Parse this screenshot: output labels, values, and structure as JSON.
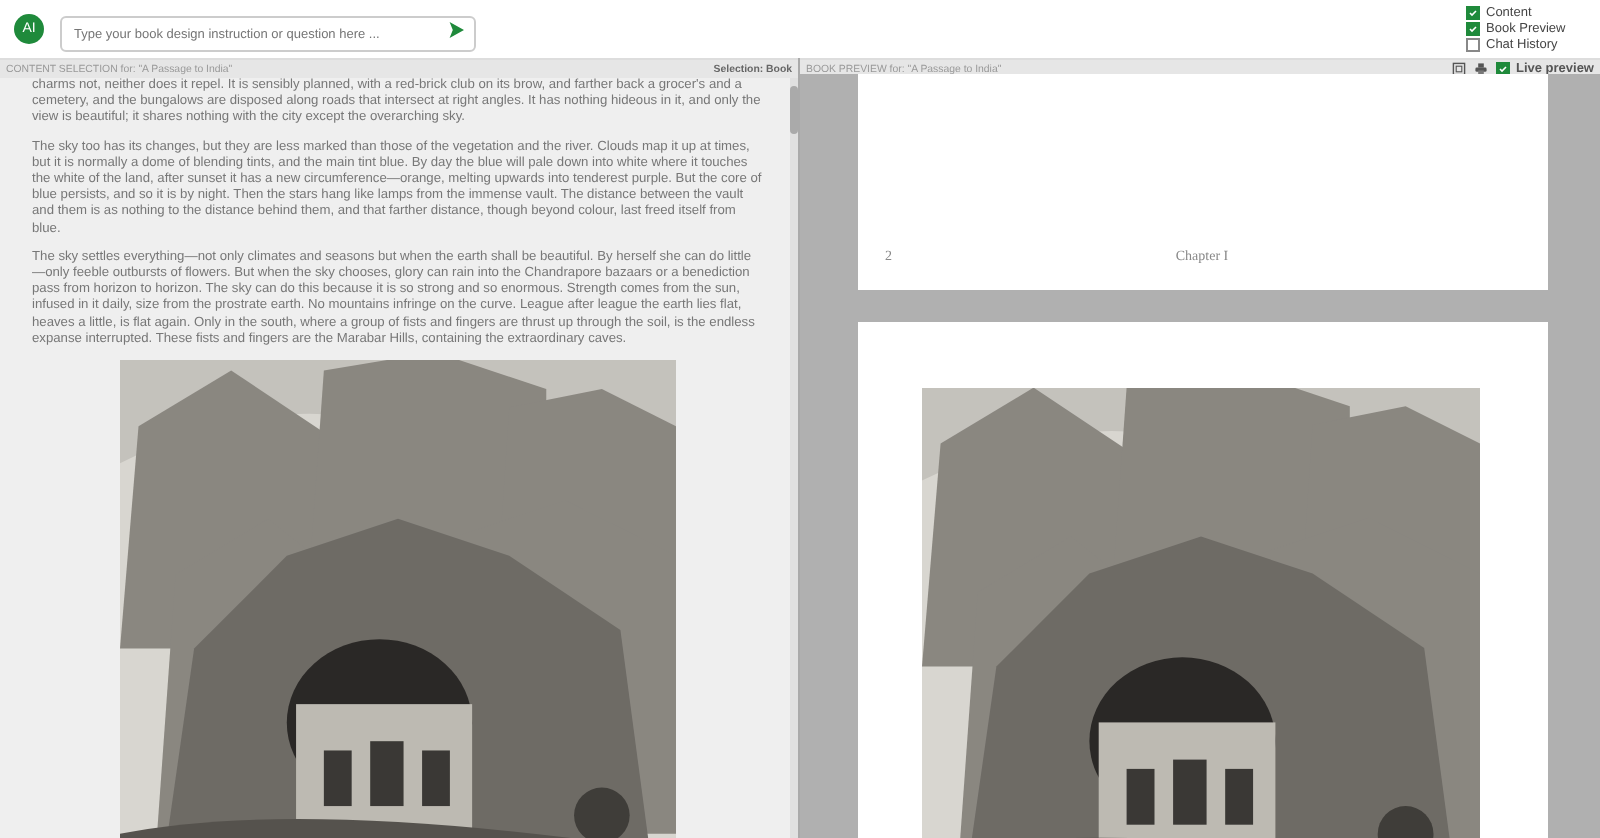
{
  "chat": {
    "avatar": "AI",
    "placeholder": "Type your book design instruction or question here ..."
  },
  "view_options": [
    {
      "label": "Content",
      "checked": true
    },
    {
      "label": "Book Preview",
      "checked": true
    },
    {
      "label": "Chat History",
      "checked": false
    }
  ],
  "content_panel": {
    "title": "CONTENT SELECTION for: \"A Passage to India\"",
    "selection": "Selection: Book",
    "paragraphs": [
      "charms not, neither does it repel. It is sensibly planned, with a red-brick club on its brow, and farther back a grocer's and a cemetery, and the bungalows are disposed along roads that intersect at right angles. It has nothing hideous in it, and only the view is beautiful; it shares nothing with the city except the overarching sky.",
      "The sky too has its changes, but they are less marked than those of the vegetation and the river. Clouds map it up at times, but it is normally a dome of blending tints, and the main tint blue. By day the blue will pale down into white where it touches the white of the land, after sunset it has a new circumference—orange, melting upwards into tenderest purple. But the core of blue persists, and so it is by night. Then the stars hang like lamps from the immense vault. The distance between the vault and them is as nothing to the distance behind them, and that farther distance, though beyond colour, last freed itself from blue.",
      "The sky settles everything—not only climates and seasons but when the earth shall be beautiful. By herself she can do little—only feeble outbursts of flowers. But when the sky chooses, glory can rain into the Chandrapore bazaars or a benediction pass from horizon to horizon. The sky can do this because it is so strong and so enormous. Strength comes from the sun, infused in it daily, size from the prostrate earth. No mountains infringe on the curve. League after league the earth lies flat, heaves a little, is flat again. Only in the south, where a group of fists and fingers are thrust up through the soil, is the endless expanse interrupted. These fists and fingers are the Marabar Hills, containing the extraordinary caves."
    ],
    "image": {
      "kind": "picture"
    }
  },
  "preview_panel": {
    "title": "BOOK PREVIEW for: \"A Passage to India\"",
    "live_preview": {
      "label": "Live preview",
      "checked": true
    },
    "pages": [
      {
        "page_number": "2",
        "running_head": "Chapter I"
      },
      {
        "image": {
          "kind": "picture"
        }
      }
    ]
  }
}
